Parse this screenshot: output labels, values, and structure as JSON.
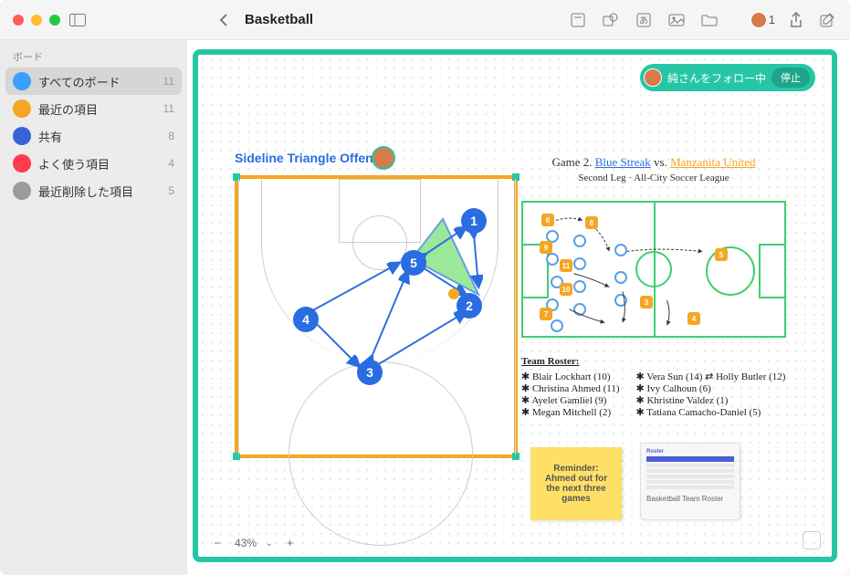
{
  "titlebar": {
    "title": "Basketball",
    "presence_count": "1"
  },
  "sidebar": {
    "header": "ボード",
    "items": [
      {
        "label": "すべてのボード",
        "badge": "11",
        "icon_bg": "#3aa0ff",
        "selected": true
      },
      {
        "label": "最近の項目",
        "badge": "11",
        "icon_bg": "#f5a623"
      },
      {
        "label": "共有",
        "badge": "8",
        "icon_bg": "#3a62d8"
      },
      {
        "label": "よく使う項目",
        "badge": "4",
        "icon_bg": "#ff3b50"
      },
      {
        "label": "最近削除した項目",
        "badge": "5",
        "icon_bg": "#9b9b9b"
      }
    ]
  },
  "follow_pill": {
    "label": "純さんをフォロー中",
    "stop": "停止"
  },
  "court": {
    "title": "Sideline Triangle Offen",
    "players": [
      "1",
      "2",
      "3",
      "4",
      "5"
    ]
  },
  "game": {
    "line1_pre": "Game 2.",
    "team_a": "Blue Streak",
    "vs": "vs.",
    "team_b": "Manzanita United",
    "line2": "Second Leg · All-City Soccer League",
    "orange_nums": [
      "6",
      "8",
      "9",
      "11",
      "10",
      "7",
      "3",
      "4",
      "5"
    ]
  },
  "roster": {
    "title": "Team Roster:",
    "left": [
      "Blair Lockhart (10)",
      "Christina Ahmed (11)",
      "Ayelet Gamliel (9)",
      "Megan Mitchell (2)"
    ],
    "right": [
      "Vera Sun (14) ⇄ Holly Butler (12)",
      "Ivy Calhoun (6)",
      "Khristine Valdez (1)",
      "Tatiana Camacho-Daniel (5)"
    ]
  },
  "sticky": {
    "text": "Reminder: Ahmed out for the next three games"
  },
  "thumbnail": {
    "title": "Roster",
    "caption": "Basketball Team Roster"
  },
  "zoom": {
    "level": "43%"
  }
}
